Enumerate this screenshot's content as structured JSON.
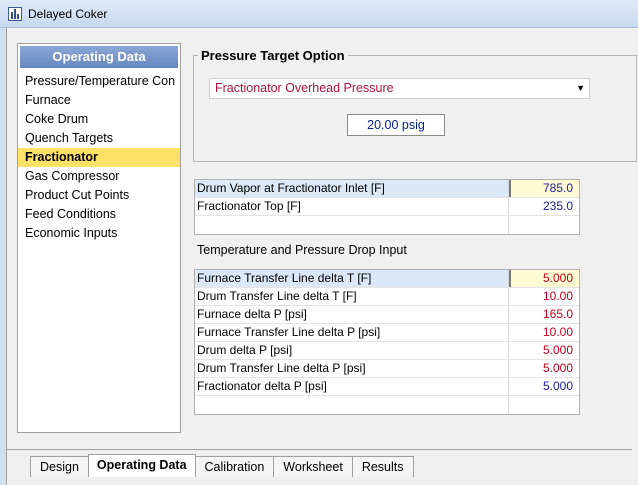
{
  "window": {
    "title": "Delayed Coker"
  },
  "sidebar": {
    "header": "Operating Data",
    "items": [
      {
        "label": "Pressure/Temperature Con"
      },
      {
        "label": "Furnace"
      },
      {
        "label": "Coke Drum"
      },
      {
        "label": "Quench Targets"
      },
      {
        "label": "Fractionator"
      },
      {
        "label": "Gas Compressor"
      },
      {
        "label": "Product Cut Points"
      },
      {
        "label": "Feed Conditions"
      },
      {
        "label": "Economic Inputs"
      }
    ],
    "selected": "Fractionator"
  },
  "pressure_target": {
    "title": "Pressure Target Option",
    "select_value": "Fractionator Overhead Pressure",
    "pressure_value": "20.00 psig"
  },
  "grid1": {
    "rows": [
      {
        "label": "Drum Vapor at Fractionator Inlet [F]",
        "value": "785.0"
      },
      {
        "label": "Fractionator Top [F]",
        "value": "235.0"
      },
      {
        "label": "",
        "value": ""
      }
    ]
  },
  "section2": {
    "title": "Temperature and Pressure Drop Input"
  },
  "grid2": {
    "rows": [
      {
        "label": "Furnace Transfer Line delta T [F]",
        "value": "5.000"
      },
      {
        "label": "Drum Transfer Line delta T [F]",
        "value": "10.00"
      },
      {
        "label": "Furnace delta P [psi]",
        "value": "165.0"
      },
      {
        "label": "Furnace Transfer Line delta P [psi]",
        "value": "10.00"
      },
      {
        "label": "Drum delta P [psi]",
        "value": "5.000"
      },
      {
        "label": "Drum Transfer Line delta P [psi]",
        "value": "5.000"
      },
      {
        "label": "Fractionator delta P [psi]",
        "value": "5.000"
      },
      {
        "label": "",
        "value": ""
      }
    ]
  },
  "tabs": [
    {
      "label": "Design"
    },
    {
      "label": "Operating Data"
    },
    {
      "label": "Calibration"
    },
    {
      "label": "Worksheet"
    },
    {
      "label": "Results"
    }
  ],
  "colors": {
    "selected_item": "#ffe168",
    "header_blue": "#6687c0",
    "value_blue": "#1d1d9e",
    "value_red": "#c4001c"
  }
}
